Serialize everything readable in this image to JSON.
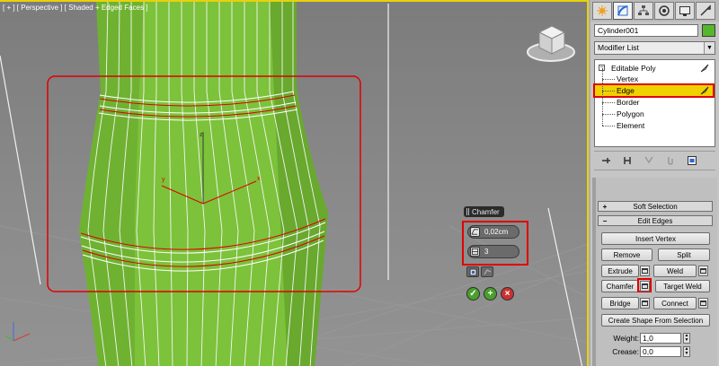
{
  "viewport": {
    "label": "[ + ] [ Perspective ] [ Shaded + Edged Faces ]",
    "viewcube_icon": "viewcube-icon",
    "mesh_color": "#7cc23a",
    "selection_color": "#e00000"
  },
  "caddy": {
    "title": "Chamfer",
    "amount": "0,02cm",
    "segments": "3",
    "ok_icon": "check-icon",
    "apply_icon": "plus-icon",
    "cancel_icon": "x-icon"
  },
  "panel": {
    "tabs": [
      "create-tab",
      "modify-tab",
      "hierarchy-tab",
      "motion-tab",
      "display-tab",
      "utilities-tab"
    ],
    "object_name": "Cylinder001",
    "object_color": "#55b82c",
    "modifier_list": "Modifier List",
    "stack": {
      "root": "Editable Poly",
      "items": [
        "Vertex",
        "Edge",
        "Border",
        "Polygon",
        "Element"
      ],
      "selected": "Edge"
    },
    "rollouts": {
      "soft_selection": "Soft Selection",
      "edit_edges": "Edit Edges"
    },
    "buttons": {
      "insert_vertex": "Insert Vertex",
      "remove": "Remove",
      "split": "Split",
      "extrude": "Extrude",
      "weld": "Weld",
      "chamfer": "Chamfer",
      "target_weld": "Target Weld",
      "bridge": "Bridge",
      "connect": "Connect",
      "create_shape": "Create Shape From Selection"
    },
    "weight_label": "Weight:",
    "weight_value": "1,0",
    "crease_label": "Crease:",
    "crease_value": "0,0"
  }
}
